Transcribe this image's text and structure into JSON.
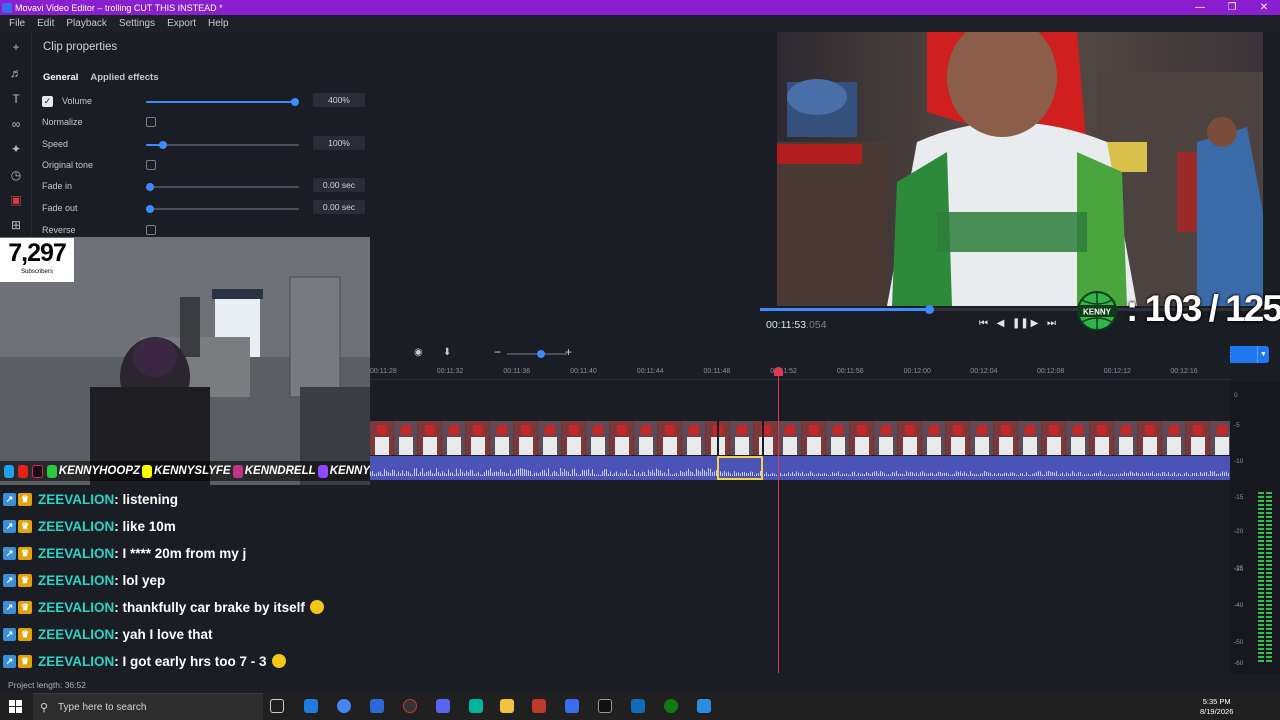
{
  "window": {
    "title": "Movavi Video Editor – trolling CUT THIS INSTEAD *"
  },
  "menu": [
    "File",
    "Edit",
    "Playback",
    "Settings",
    "Export",
    "Help"
  ],
  "clip_properties": {
    "title": "Clip properties",
    "tabs": [
      {
        "label": "General",
        "active": true
      },
      {
        "label": "Applied effects",
        "active": false
      }
    ],
    "volume": {
      "label": "Volume",
      "value": "400%",
      "level": 1.0,
      "checked": true
    },
    "normalize": {
      "label": "Normalize",
      "checked": false
    },
    "speed": {
      "label": "Speed",
      "value": "100%",
      "level": 0.1
    },
    "original_tone": {
      "label": "Original tone",
      "checked": false
    },
    "fade_in": {
      "label": "Fade in",
      "value": "0.00 sec",
      "level": 0
    },
    "fade_out": {
      "label": "Fade out",
      "value": "0.00 sec",
      "level": 0
    },
    "reverse": {
      "label": "Reverse",
      "checked": false
    }
  },
  "player": {
    "timecode_main": "00:11:53",
    "timecode_ms": ".054",
    "progress": 0.33,
    "aspect": "16:9"
  },
  "overlay": {
    "subscribers_count": "7,297",
    "subscribers_label": "Subscribers",
    "goal_counter": ": 103 / 125",
    "logo_text": "KENNY",
    "socials": [
      "KENNYHOOPZ",
      "KENNYSLYFE",
      "KENNDRELL",
      "KENNY"
    ]
  },
  "export": {
    "label": "Export"
  },
  "timeline": {
    "ruler_ticks": [
      "00:11:28",
      "00:11:32",
      "00:11:36",
      "00:11:40",
      "00:11:44",
      "00:11:48",
      "00:11:52",
      "00:11:56",
      "00:12:00",
      "00:12:04",
      "00:12:08",
      "00:12:12",
      "00:12:16"
    ],
    "meter_labels": [
      "0",
      "-5",
      "-10",
      "-15",
      "-20",
      "-25",
      "-30",
      "-40",
      "-50",
      "-60"
    ]
  },
  "chat": [
    {
      "user": "ZEEVALION",
      "message": ": listening",
      "emoji": false
    },
    {
      "user": "ZEEVALION",
      "message": ": like 10m",
      "emoji": false
    },
    {
      "user": "ZEEVALION",
      "message": ": I **** 20m from my j",
      "emoji": false
    },
    {
      "user": "ZEEVALION",
      "message": ": lol yep",
      "emoji": false
    },
    {
      "user": "ZEEVALION",
      "message": ": thankfully car brake by itself",
      "emoji": true
    },
    {
      "user": "ZEEVALION",
      "message": ": yah I love that",
      "emoji": false
    },
    {
      "user": "ZEEVALION",
      "message": ": I got early hrs too 7 - 3",
      "emoji": true
    }
  ],
  "status": {
    "project_length": "Project length: 36:52"
  },
  "taskbar": {
    "search_placeholder": "Type here to search",
    "time": "5:35 PM",
    "date": "8/19/2026"
  },
  "colors": {
    "accent": "#3d8bff",
    "titlebar": "#8a1fd0",
    "playhead": "#e0384f",
    "chat_user": "#2ad4c4"
  }
}
